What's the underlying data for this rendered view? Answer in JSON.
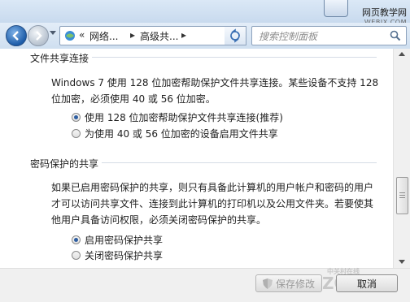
{
  "watermark": {
    "text": "网页教学网",
    "sub": "WEBJX.COM"
  },
  "nav": {
    "breadcrumb_prefix": "«",
    "breadcrumb": [
      "网络...",
      "高级共..."
    ],
    "search_placeholder": "搜索控制面板"
  },
  "sections": {
    "file_sharing": {
      "title": "文件共享连接",
      "description_line1": "Windows 7 使用 128 位加密帮助保护文件共享连接。某些设备不支持 128",
      "description_line2": "位加密，必须使用 40 或 56 位加密。",
      "options": [
        {
          "label": "使用 128 位加密帮助保护文件共享连接(推荐)",
          "selected": true
        },
        {
          "label": "为使用 40 或 56 位加密的设备启用文件共享",
          "selected": false
        }
      ]
    },
    "password_sharing": {
      "title": "密码保护的共享",
      "description_line1": "如果已启用密码保护的共享，则只有具备此计算机的用户帐户和密码的用户",
      "description_line2": "才可以访问共享文件、连接到此计算机的打印机以及公用文件夹。若要使其",
      "description_line3": "他用户具备访问权限，必须关闭密码保护的共享。",
      "options": [
        {
          "label": "启用密码保护共享",
          "selected": true
        },
        {
          "label": "关闭密码保护共享",
          "selected": false
        }
      ]
    }
  },
  "footer": {
    "save_label": "保存修改",
    "cancel_label": "取消",
    "watermark_main": "ZOL",
    "watermark_small": "中关村在线"
  },
  "colors": {
    "accent": "#2e5ea1",
    "nav_bg": "#cfdff0"
  }
}
